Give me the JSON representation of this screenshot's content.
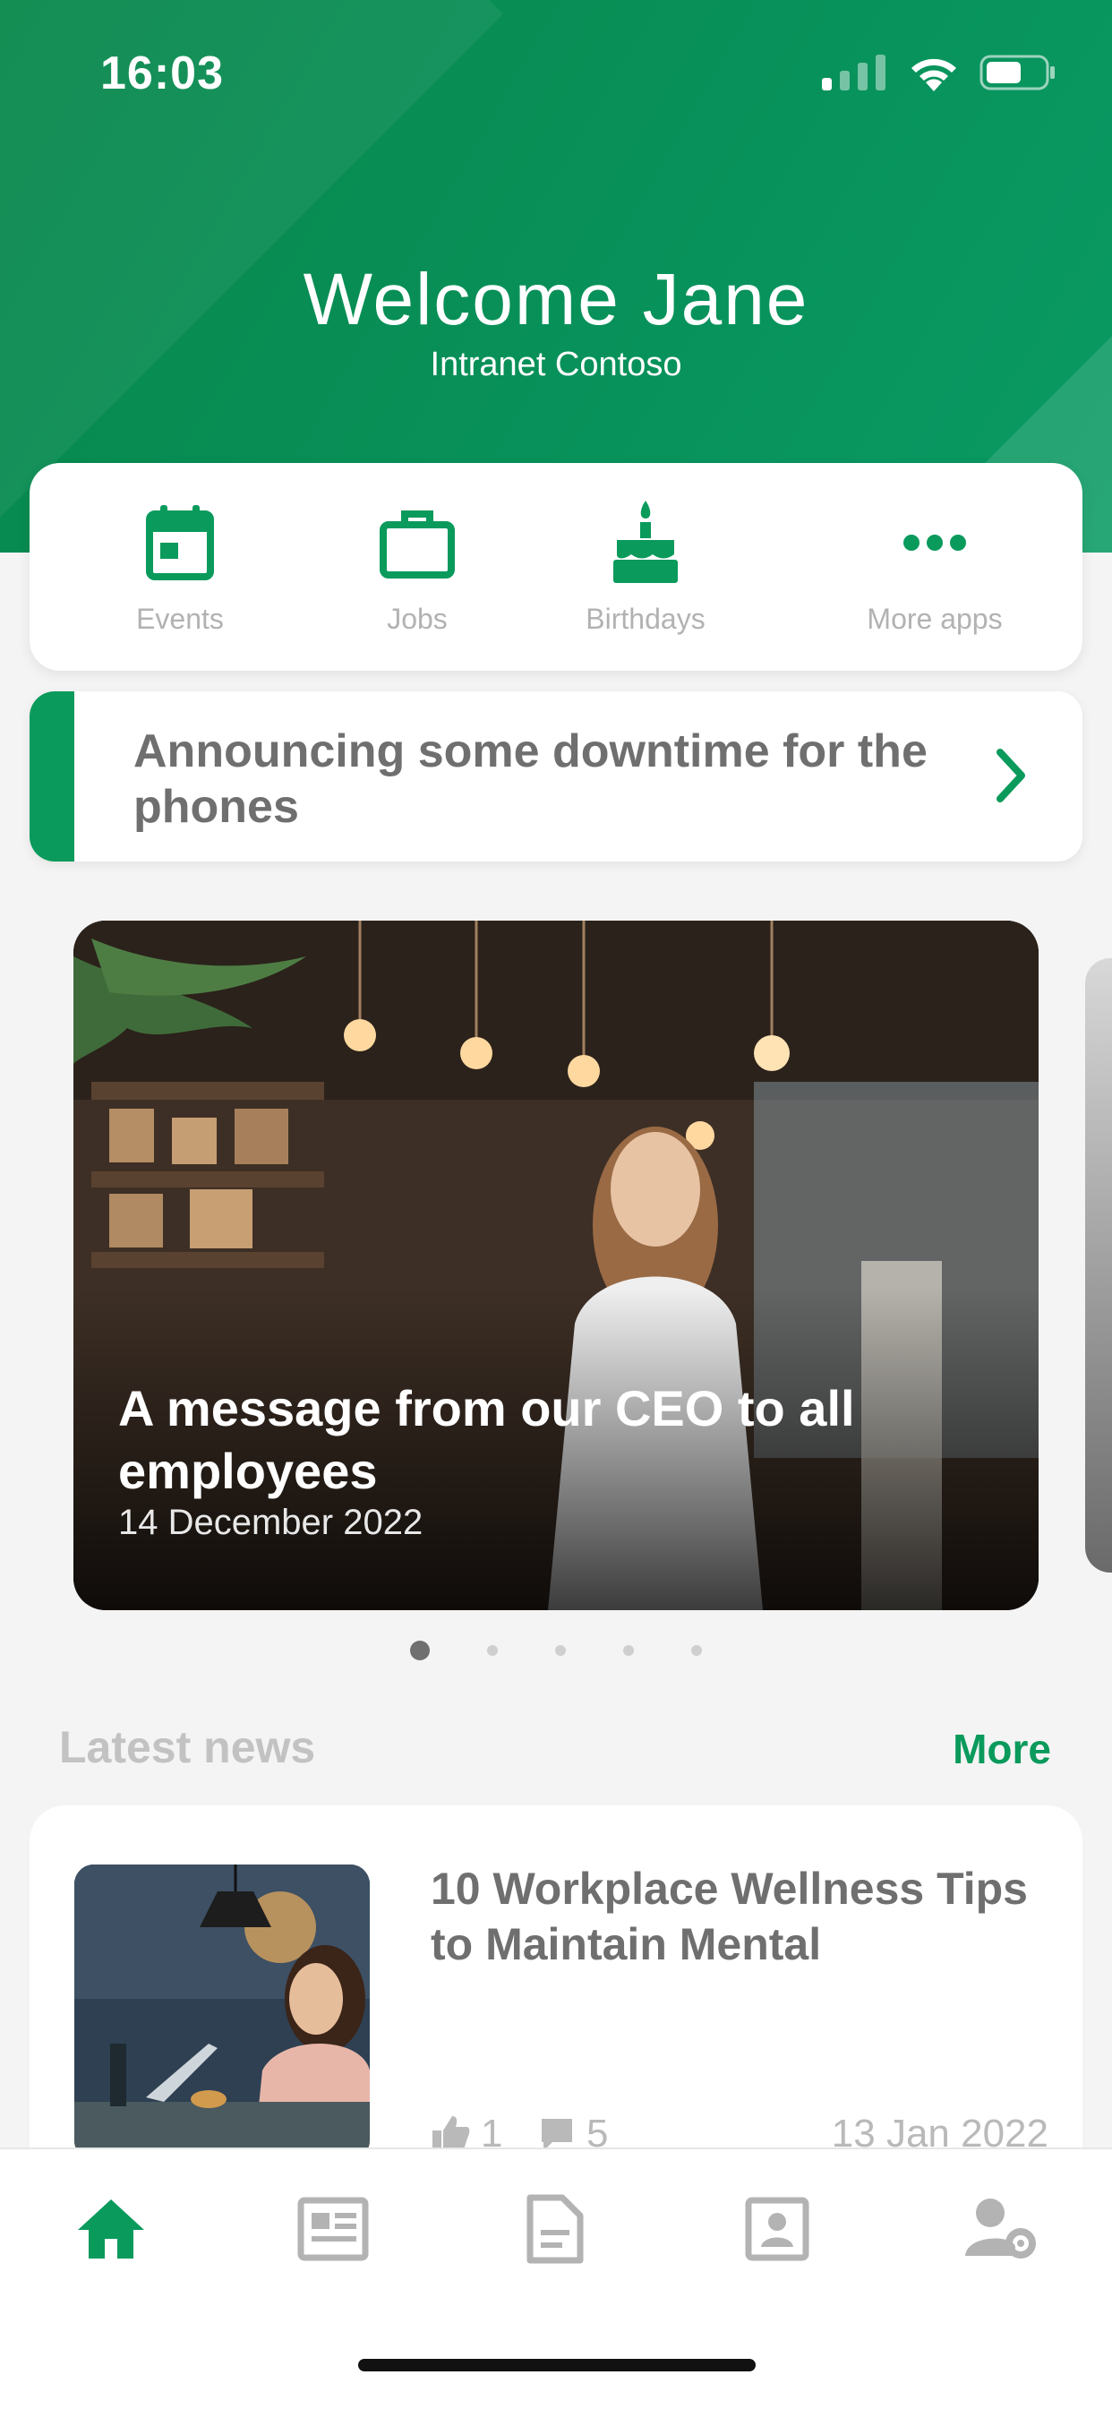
{
  "status_bar": {
    "time": "16:03"
  },
  "header": {
    "welcome": "Welcome Jane",
    "subtitle": "Intranet Contoso"
  },
  "apps": [
    {
      "label": "Events",
      "icon": "calendar-icon"
    },
    {
      "label": "Jobs",
      "icon": "briefcase-icon"
    },
    {
      "label": "Birthdays",
      "icon": "cake-icon"
    },
    {
      "label": "More apps",
      "icon": "more-dots-icon"
    }
  ],
  "announcement": {
    "text": "Announcing some downtime for the phones"
  },
  "carousel": {
    "title": "A message from our CEO to all employees",
    "date": "14 December 2022",
    "page_count": 5,
    "active_page": 1
  },
  "latest_news": {
    "title": "Latest news",
    "more_label": "More",
    "items": [
      {
        "title": "10 Workplace Wellness Tips to Maintain Mental",
        "likes": "1",
        "comments": "5",
        "date": "13 Jan 2022"
      }
    ]
  },
  "tabbar": [
    {
      "icon": "home-icon",
      "active": true
    },
    {
      "icon": "news-icon",
      "active": false
    },
    {
      "icon": "document-icon",
      "active": false
    },
    {
      "icon": "contact-icon",
      "active": false
    },
    {
      "icon": "user-settings-icon",
      "active": false
    }
  ],
  "colors": {
    "brand_green": "#0a9a5c",
    "muted_text": "#6f6f6f",
    "label_grey": "#b2b2b2"
  }
}
